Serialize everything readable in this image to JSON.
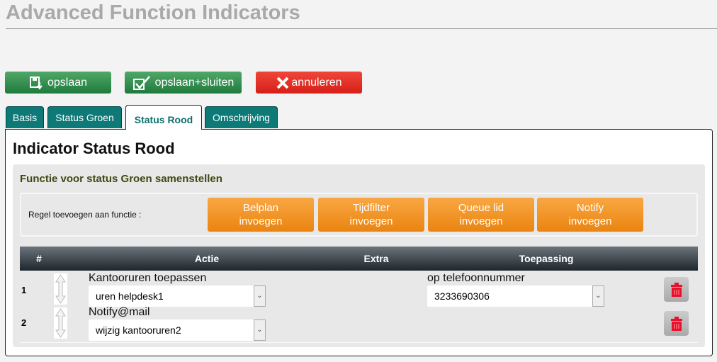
{
  "page": {
    "title": "Advanced Function Indicators"
  },
  "toolbar": {
    "save": "opslaan",
    "save_close": "opslaan+sluiten",
    "cancel": "annuleren"
  },
  "tabs": [
    {
      "label": "Basis"
    },
    {
      "label": "Status Groen"
    },
    {
      "label": "Status Rood",
      "active": true
    },
    {
      "label": "Omschrijving"
    }
  ],
  "panel": {
    "heading": "Indicator Status Rood",
    "subheading": "Functie voor status Groen samenstellen",
    "add_label": "Regel toevoegen aan functie :",
    "add_buttons": [
      {
        "l1": "Belplan",
        "l2": "invoegen"
      },
      {
        "l1": "Tijdfilter",
        "l2": "invoegen"
      },
      {
        "l1": "Queue lid",
        "l2": "invoegen"
      },
      {
        "l1": "Notify",
        "l2": "invoegen"
      }
    ]
  },
  "table": {
    "headers": {
      "num": "#",
      "action": "Actie",
      "extra": "Extra",
      "application": "Toepassing"
    },
    "rows": [
      {
        "num": "1",
        "action_label": "Kantooruren toepassen",
        "action_value": "uren helpdesk1",
        "application_label": "op telefoonnummer",
        "application_value": "3233690306"
      },
      {
        "num": "2",
        "action_label": "Notify@mail",
        "action_value": "wijzig kantooruren2"
      }
    ]
  },
  "colors": {
    "accent_green": "#1f7a3e",
    "danger_red": "#d52018",
    "tab_teal": "#0d7a78",
    "orange": "#ea8410"
  }
}
